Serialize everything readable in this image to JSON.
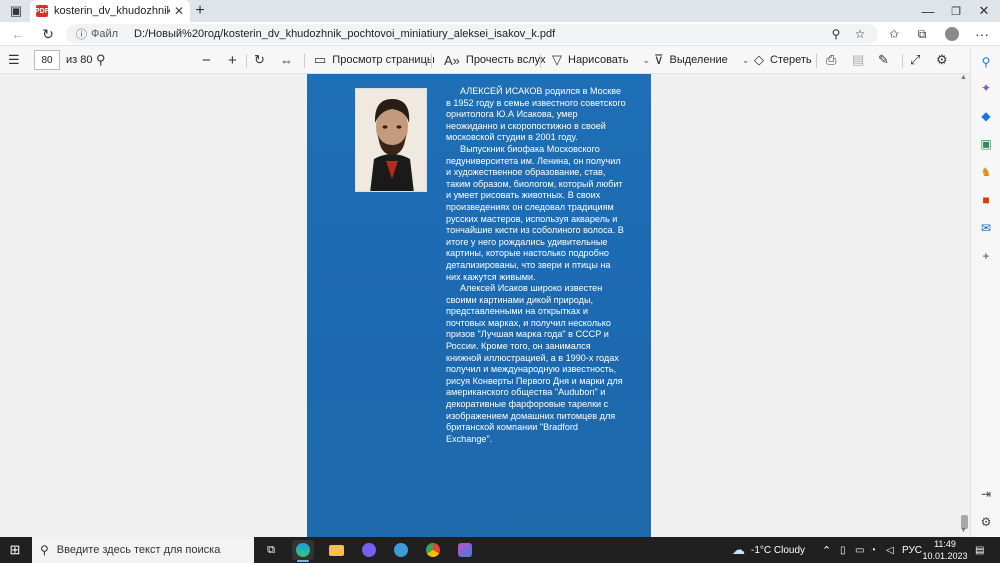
{
  "browser": {
    "tab_title": "kosterin_dv_khudozhnik_pochtovoi_miniatiury_aleksei_isakov_k.pdf",
    "tab_close": "✕",
    "new_tab": "+",
    "window_min": "—",
    "window_max": "❐",
    "window_close": "✕",
    "address_label": "Файл",
    "address_url": "D:/Новый%20год/kosterin_dv_khudozhnik_pochtovoi_miniatiury_aleksei_isakov_k.pdf",
    "more_menu": "···"
  },
  "pdf_toolbar": {
    "page_number": "80",
    "page_total": "из 80",
    "view_label": "Просмотр страницы",
    "read_aloud_label": "Прочесть вслух",
    "draw_label": "Нарисовать",
    "highlight_label": "Выделение",
    "erase_label": "Стереть"
  },
  "document": {
    "paragraph1": "АЛЕКСЕЙ ИСАКОВ родился в Москве в 1952 году в семье известного советского орнитолога Ю.А Исакова, умер неожиданно и скоропостижно в своей московской студии в 2001 году.",
    "paragraph2": "Выпускник биофака Московского педуниверситета им. Ленина, он получил и художественное образование, став, таким образом, биологом, который любит и умеет рисовать животных. В своих произведениях он следовал традициям русских мастеров, используя акварель и тончайшие кисти из соболиного волоса. В итоге у него рождались удивительные картины, которые настолько подробно детализированы, что звери и птицы на них кажутся живыми.",
    "paragraph3": "Алексей Исаков широко известен своими картинами дикой природы, представленными на открытках и почтовых марках, и получил несколько призов \"Лучшая марка года\" в СССР и России. Кроме того, он занимался книжной иллюстрацией, а в 1990-х годах получил и международную известность, рисуя Конверты Первого Дня и марки для американского общества \"Audubon\" и декоративные фарфоровые тарелки с изображением домашних питомцев для британской компании \"Bradford Exchange\"."
  },
  "taskbar": {
    "search_placeholder": "Введите здесь текст для поиска",
    "weather": "-1°C Cloudy",
    "language": "РУС",
    "time": "11:49",
    "date": "10.01.2023"
  },
  "colors": {
    "page_blue": "#1f6fb6",
    "taskbar": "#202020"
  }
}
